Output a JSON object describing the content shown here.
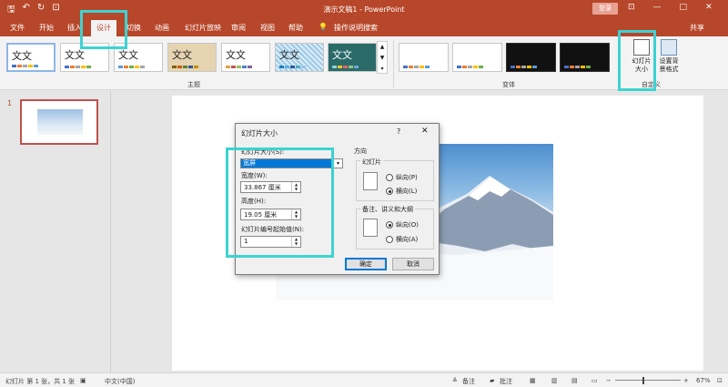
{
  "window": {
    "title": "演示文稿1  -  PowerPoint",
    "login": "登录",
    "share": "共享"
  },
  "qat": {
    "save": "🖫",
    "undo": "↶",
    "redo": "↻",
    "present": "⊡"
  },
  "winctl": {
    "ribbon_opts": "⊡",
    "minimize": "—",
    "restore": "□",
    "close": "✕"
  },
  "tabs": [
    "文件",
    "开始",
    "插入",
    "设计",
    "切换",
    "动画",
    "幻灯片放映",
    "审阅",
    "视图",
    "帮助",
    "操作说明搜索"
  ],
  "ribbon": {
    "themes_group": "主题",
    "variants_group": "变体",
    "customize_group": "自定义",
    "theme_sample": "文文",
    "slide_size_label": "幻灯片\n大小",
    "format_bg_label": "设置背\n景格式"
  },
  "thumbnails": {
    "slide_number": "1"
  },
  "dialog": {
    "title": "幻灯片大小",
    "help": "?",
    "close": "✕",
    "size_label": "幻灯片大小(S):",
    "size_value": "宽屏",
    "width_label": "宽度(W):",
    "width_value": "33.867 厘米",
    "height_label": "高度(H):",
    "height_value": "19.05 厘米",
    "start_label": "幻灯片编号起始值(N):",
    "start_value": "1",
    "orientation": "方向",
    "slides": "幻灯片",
    "portrait": "纵向(P)",
    "landscape": "横向(L)",
    "notes": "备注、讲义和大纲",
    "notes_portrait": "纵向(O)",
    "notes_landscape": "横向(A)",
    "ok": "确定",
    "cancel": "取消"
  },
  "status": {
    "slide_info": "幻灯片 第 1 张，共 1 张",
    "language": "中文(中国)",
    "notes": "备注",
    "comments": "批注",
    "zoom": "67%"
  },
  "colors": {
    "accent": "#b7472a",
    "highlight": "#3cd3d1",
    "selection": "#0078d7"
  }
}
